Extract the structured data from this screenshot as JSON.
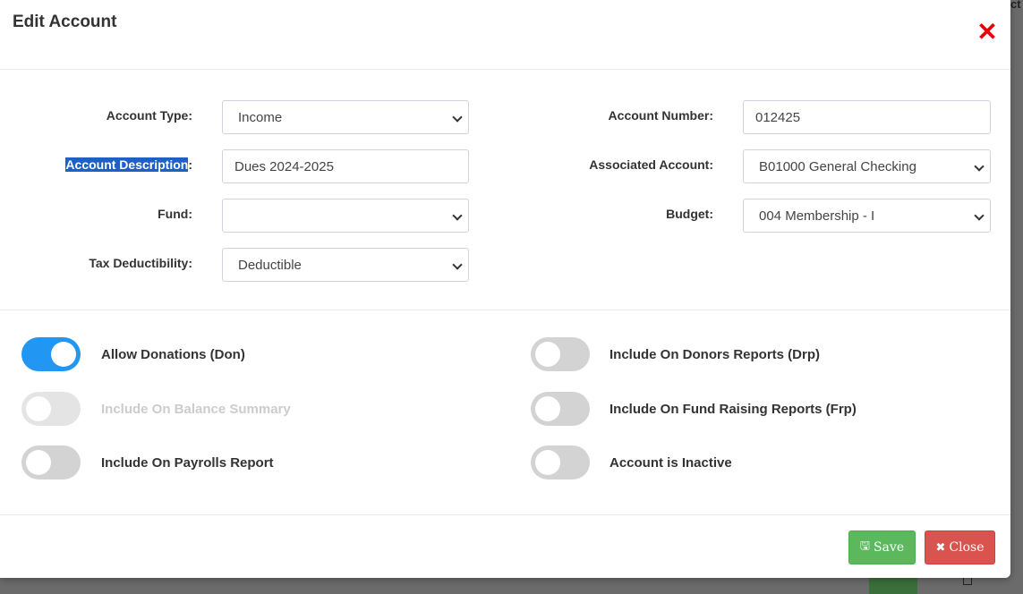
{
  "modal": {
    "title": "Edit Account",
    "close_icon": "close-icon"
  },
  "form": {
    "account_type": {
      "label": "Account Type:",
      "value": "Income"
    },
    "account_description": {
      "label_highlighted": "Account Description",
      "label_suffix": ":",
      "value": "Dues 2024-2025"
    },
    "fund": {
      "label": "Fund:",
      "value": ""
    },
    "tax_deductibility": {
      "label": "Tax Deductibility:",
      "value": "Deductible"
    },
    "account_number": {
      "label": "Account Number:",
      "value": "012425"
    },
    "associated_account": {
      "label": "Associated Account:",
      "value": "B01000 General Checking"
    },
    "budget": {
      "label": "Budget:",
      "value": "004 Membership - I"
    }
  },
  "toggles": {
    "allow_donations": {
      "label": "Allow Donations (Don)",
      "on": true
    },
    "balance_summary": {
      "label": "Include On Balance Summary",
      "on": false,
      "disabled": true
    },
    "payrolls_report": {
      "label": "Include On Payrolls Report",
      "on": false
    },
    "donors_reports": {
      "label": "Include On Donors Reports (Drp)",
      "on": false
    },
    "fund_raising_reports": {
      "label": "Include On Fund Raising Reports (Frp)",
      "on": false
    },
    "account_inactive": {
      "label": "Account is Inactive",
      "on": false
    }
  },
  "footer": {
    "save_label": "Save",
    "save_icon": "floppy-icon",
    "close_label": "Close",
    "close_icon": "x-icon"
  },
  "colors": {
    "toggle_on": "#2196f3",
    "save": "#5cb85c",
    "close": "#d9534f",
    "close_x": "#e8000b",
    "highlight": "#1f60c4"
  }
}
